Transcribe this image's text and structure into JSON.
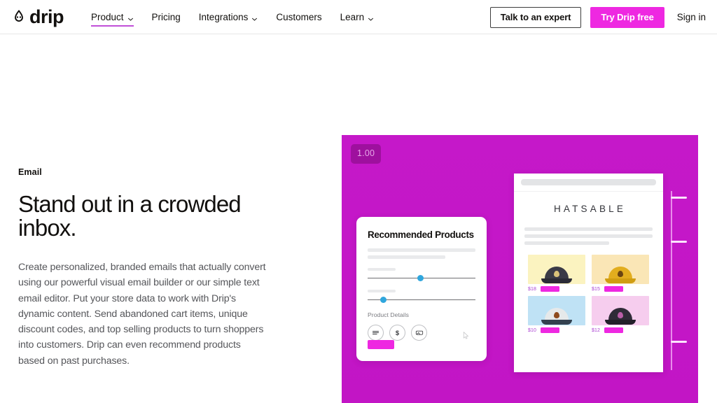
{
  "header": {
    "brand": {
      "name": "drip",
      "icon": "drip-droplet-smiley-logo"
    },
    "nav": [
      {
        "label": "Product",
        "has_caret": true,
        "active": true
      },
      {
        "label": "Pricing",
        "has_caret": false,
        "active": false
      },
      {
        "label": "Integrations",
        "has_caret": true,
        "active": false
      },
      {
        "label": "Customers",
        "has_caret": false,
        "active": false
      },
      {
        "label": "Learn",
        "has_caret": true,
        "active": false
      }
    ],
    "expert_button": "Talk to an expert",
    "trial_button": "Try Drip free",
    "signin_link": "Sign in"
  },
  "hero": {
    "eyebrow": "Email",
    "headline": "Stand out in a crowded inbox.",
    "body": "Create personalized, branded emails that actually convert using our powerful visual email builder or our simple text email editor. Put your store data to work with Drip's dynamic content. Send abandoned cart items, unique discount codes, and top selling products to turn shoppers into customers. Drip can even recommend products based on past purchases."
  },
  "stage": {
    "version_badge": "1.00",
    "background_color": "#c616c6",
    "rec_panel": {
      "title": "Recommended Products",
      "sub_label": "Product Details",
      "sliders": [
        {
          "name": "slider-one",
          "position_pct": 46
        },
        {
          "name": "slider-two",
          "position_pct": 12
        }
      ],
      "icons": [
        "lines-icon",
        "dollar-icon",
        "image-block-icon"
      ],
      "cursor_icon": "drag-cursor-icon",
      "cta_color": "#ee28e1"
    },
    "email_preview": {
      "logo": "HATSABLE",
      "products": [
        {
          "price": "$18",
          "swatch": "#fbf3c0",
          "cap_color": "#3a3a46",
          "brim_color": "#2b2b36",
          "badge_color": "#d9c27a"
        },
        {
          "price": "$15",
          "swatch": "#fae6b6",
          "cap_color": "#e2ad1e",
          "brim_color": "#d09d12",
          "badge_color": "#6a4412"
        },
        {
          "price": "$10",
          "swatch": "#bfe2f5",
          "cap_color": "#e6e9ea",
          "brim_color": "#33414f",
          "badge_color": "#8e4a1e"
        },
        {
          "price": "$12",
          "swatch": "#f6cdee",
          "cap_color": "#2f2b38",
          "brim_color": "#23202a",
          "badge_color": "#b95fa8"
        }
      ],
      "cta_color": "#6c5ce7"
    },
    "rail_ticks": 3
  }
}
